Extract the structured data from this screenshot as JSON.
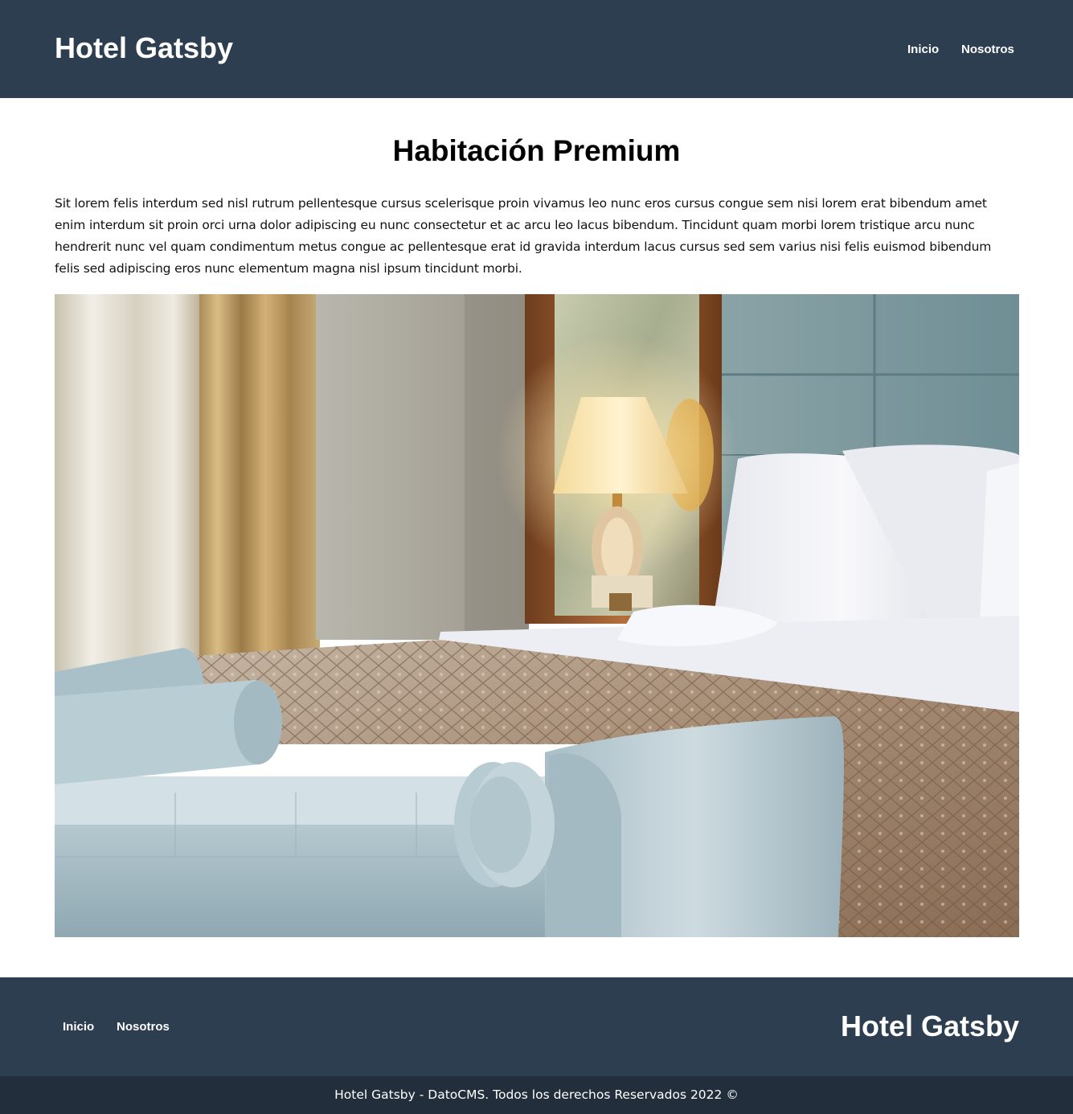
{
  "header": {
    "brand": "Hotel Gatsby",
    "nav": [
      "Inicio",
      "Nosotros"
    ]
  },
  "main": {
    "title": "Habitación Premium",
    "description": "Sit lorem felis interdum sed nisl rutrum pellentesque cursus scelerisque proin vivamus leo nunc eros cursus congue sem nisi lorem erat bibendum amet enim interdum sit proin orci urna dolor adipiscing eu nunc consectetur et ac arcu leo lacus bibendum. Tincidunt quam morbi lorem tristique arcu nunc hendrerit nunc vel quam condimentum metus congue ac pellentesque erat id gravida interdum lacus cursus sed sem varius nisi felis euismod bibendum felis sed adipiscing eros nunc elementum magna nisl ipsum tincidunt morbi."
  },
  "footer": {
    "nav": [
      "Inicio",
      "Nosotros"
    ],
    "brand": "Hotel Gatsby",
    "copyright": "Hotel Gatsby - DatoCMS. Todos los derechos Reservados 2022 ©"
  },
  "colors": {
    "header_bg": "#2d3e50",
    "copyright_bg": "#222e3b",
    "text": "#111111"
  }
}
